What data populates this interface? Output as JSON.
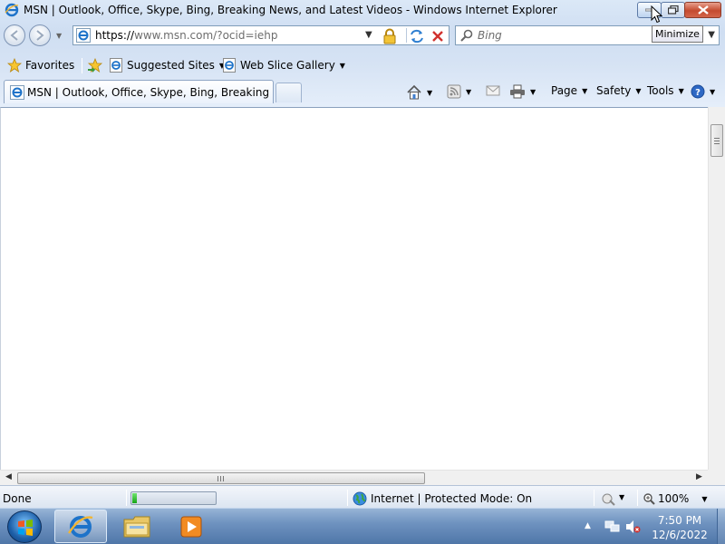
{
  "window": {
    "title": "MSN | Outlook, Office, Skype, Bing, Breaking News, and Latest Videos - Windows Internet Explorer",
    "tooltip": "Minimize"
  },
  "address_bar": {
    "protocol": "https://",
    "url_rest": "www.msn.com/?ocid=iehp"
  },
  "search": {
    "placeholder": "Bing"
  },
  "favorites_bar": {
    "favorites_label": "Favorites",
    "items": [
      {
        "label": "Suggested Sites"
      },
      {
        "label": "Web Slice Gallery"
      }
    ]
  },
  "tab": {
    "title": "MSN | Outlook, Office, Skype, Bing, Breaking Ne..."
  },
  "command_bar": {
    "page_label": "Page",
    "safety_label": "Safety",
    "tools_label": "Tools"
  },
  "status_bar": {
    "status_text": "Done",
    "progress_fraction": 0.04,
    "zone_text": "Internet | Protected Mode: On",
    "zoom_text": "100%"
  },
  "taskbar": {
    "time": "7:50 PM",
    "date": "12/6/2022"
  },
  "colors": {
    "chrome_bg": "#d6e3f4",
    "taskbar": "#5b81b3",
    "progress": "#16a516",
    "close_button": "#c44a2f"
  }
}
